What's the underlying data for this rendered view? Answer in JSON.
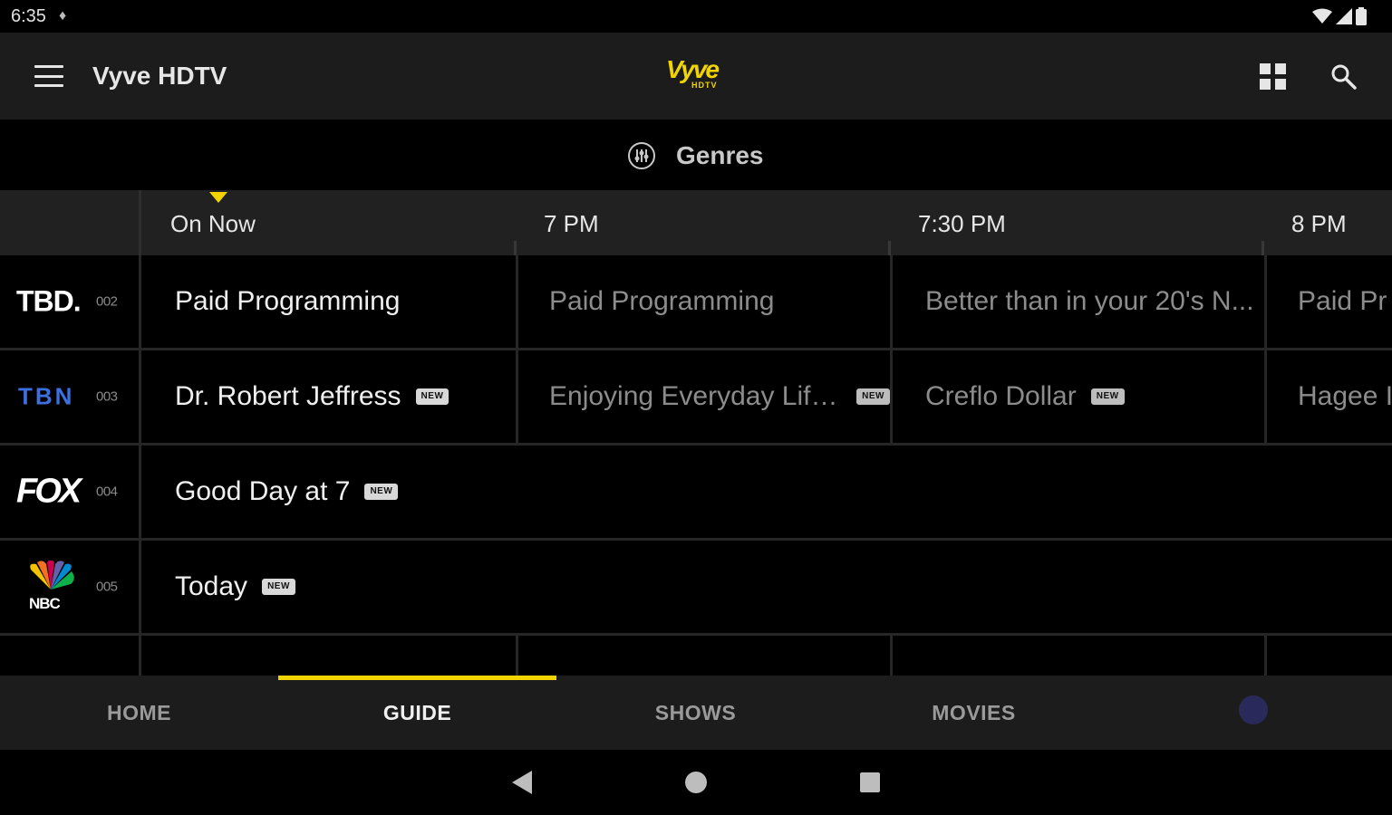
{
  "status_bar": {
    "time": "6:35"
  },
  "app_bar": {
    "title": "Vyve HDTV",
    "logo_text": "Vyve",
    "logo_subtext": "HDTV"
  },
  "genres": {
    "label": "Genres"
  },
  "time_header": {
    "slots": [
      "On Now",
      "7 PM",
      "7:30 PM",
      "8 PM"
    ]
  },
  "channels": [
    {
      "logo": "TBD.",
      "number": "002",
      "programs": [
        {
          "title": "Paid Programming",
          "new": false
        },
        {
          "title": "Paid Programming",
          "new": false
        },
        {
          "title": "Better than in your 20's N...",
          "new": false
        },
        {
          "title": "Paid Pr",
          "new": false
        }
      ]
    },
    {
      "logo": "TBN",
      "number": "003",
      "programs": [
        {
          "title": "Dr. Robert Jeffress",
          "new": true
        },
        {
          "title": "Enjoying Everyday Life w...",
          "new": true
        },
        {
          "title": "Creflo Dollar",
          "new": true
        },
        {
          "title": "Hagee I",
          "new": false
        }
      ]
    },
    {
      "logo": "FOX",
      "number": "004",
      "programs": [
        {
          "title": "Good Day at 7",
          "new": true
        }
      ]
    },
    {
      "logo": "NBC",
      "number": "005",
      "programs": [
        {
          "title": "Today",
          "new": true
        }
      ]
    }
  ],
  "badge_label": "NEW",
  "bottom_nav": {
    "items": [
      "HOME",
      "GUIDE",
      "SHOWS",
      "MOVIES"
    ],
    "active": "GUIDE"
  },
  "colors": {
    "accent": "#f2d400",
    "app_bar": "#1c1c1c",
    "background": "#000000",
    "time_header": "#212121"
  }
}
